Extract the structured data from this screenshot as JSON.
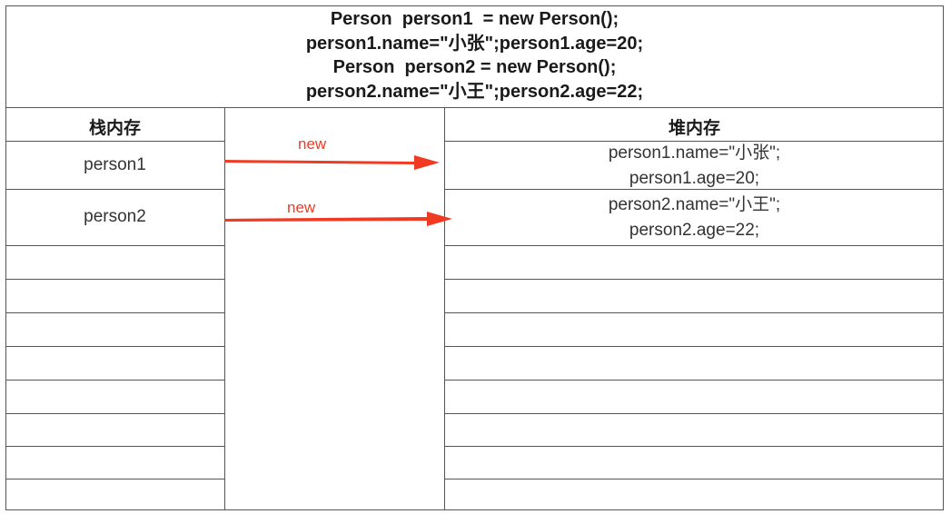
{
  "code_lines": [
    "Person  person1  = new Person();",
    "person1.name=\"小张\";person1.age=20;",
    "Person  person2 = new Person();",
    "person2.name=\"小王\";person2.age=22;"
  ],
  "table": {
    "stack_header": "栈内存",
    "heap_header": "堆内存"
  },
  "rows": [
    {
      "stack_var": "person1",
      "arrow_label": "new",
      "heap_lines": [
        "person1.name=\"小张\";",
        "person1.age=20;"
      ]
    },
    {
      "stack_var": "person2",
      "arrow_label": "new",
      "heap_lines": [
        "person2.name=\"小王\";",
        "person2.age=22;"
      ]
    }
  ],
  "colors": {
    "arrow": "#f03a22",
    "grid": "#555555",
    "text": "#222222"
  }
}
